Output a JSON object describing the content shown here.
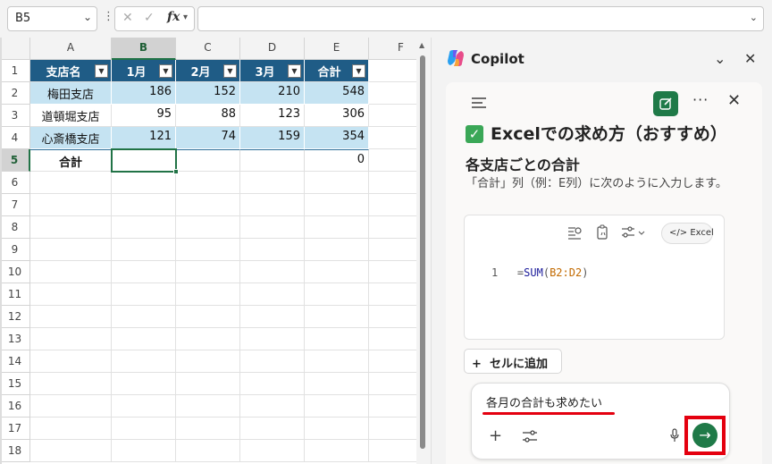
{
  "formula_bar": {
    "name_box": "B5",
    "name_box_chevron": "⌄",
    "more_dots": "⋮",
    "cancel_glyph": "✕",
    "enter_glyph": "✓",
    "fx_label": "fx",
    "formula": ""
  },
  "sheet": {
    "columns": [
      "A",
      "B",
      "C",
      "D",
      "E",
      "F"
    ],
    "selected_column": "B",
    "rows": [
      "1",
      "2",
      "3",
      "4",
      "5",
      "6",
      "7",
      "8",
      "9",
      "10",
      "11",
      "12",
      "13",
      "14",
      "15",
      "16",
      "17",
      "18"
    ],
    "selected_row": "5",
    "table": {
      "headers": [
        "支店名",
        "1月",
        "2月",
        "3月",
        "合計"
      ],
      "data": [
        {
          "name": "梅田支店",
          "m1": "186",
          "m2": "152",
          "m3": "210",
          "total": "548"
        },
        {
          "name": "道頓堀支店",
          "m1": "95",
          "m2": "88",
          "m3": "123",
          "total": "306"
        },
        {
          "name": "心斎橋支店",
          "m1": "121",
          "m2": "74",
          "m3": "159",
          "total": "354"
        }
      ],
      "total_row": {
        "label": "合計",
        "m1": "",
        "m2": "",
        "m3": "",
        "total": "0"
      }
    },
    "active_cell": "B5"
  },
  "copilot": {
    "title": "Copilot",
    "header_controls": {
      "collapse": "⌄",
      "close": "✕"
    },
    "chat_toolbar": {
      "more": "···",
      "close": "✕"
    },
    "response": {
      "heading": "Excelでの求め方（おすすめ）",
      "heading_check": "✓",
      "subheading": "各支店ごとの合計",
      "text": "「合計」列（例：E列）に次のように入力します。",
      "code_language": "Excel",
      "code_line_number": "1",
      "code": {
        "prefix": "=",
        "func": "SUM",
        "open": "(",
        "range": "B2:D2",
        "close": ")"
      }
    },
    "add_to_cell_label": "セルに追加",
    "add_to_cell_icon": "+",
    "composer": {
      "text": "各月の合計も求めたい",
      "add_icon": "+",
      "send_icon": "→"
    },
    "colors": {
      "accent_green": "#1f7a48",
      "table_header": "#1f5c86",
      "table_band": "#c5e3f2",
      "highlight_red": "#e4000f"
    }
  }
}
